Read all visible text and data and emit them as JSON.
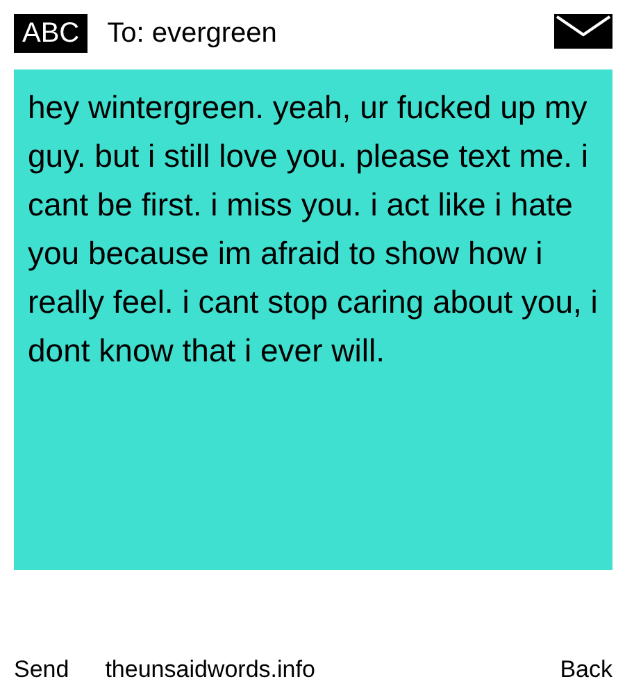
{
  "header": {
    "keyboard_mode": "ABC",
    "recipient": "To: evergreen"
  },
  "message": {
    "body": "hey wintergreen. yeah, ur fucked up my guy. but i still love you. please text me. i cant be first. i miss you. i act like i hate you because im afraid to show how i really feel. i cant stop caring about you, i dont know that i ever will."
  },
  "footer": {
    "left": "Send",
    "center": "theunsaidwords.info",
    "right": "Back"
  }
}
